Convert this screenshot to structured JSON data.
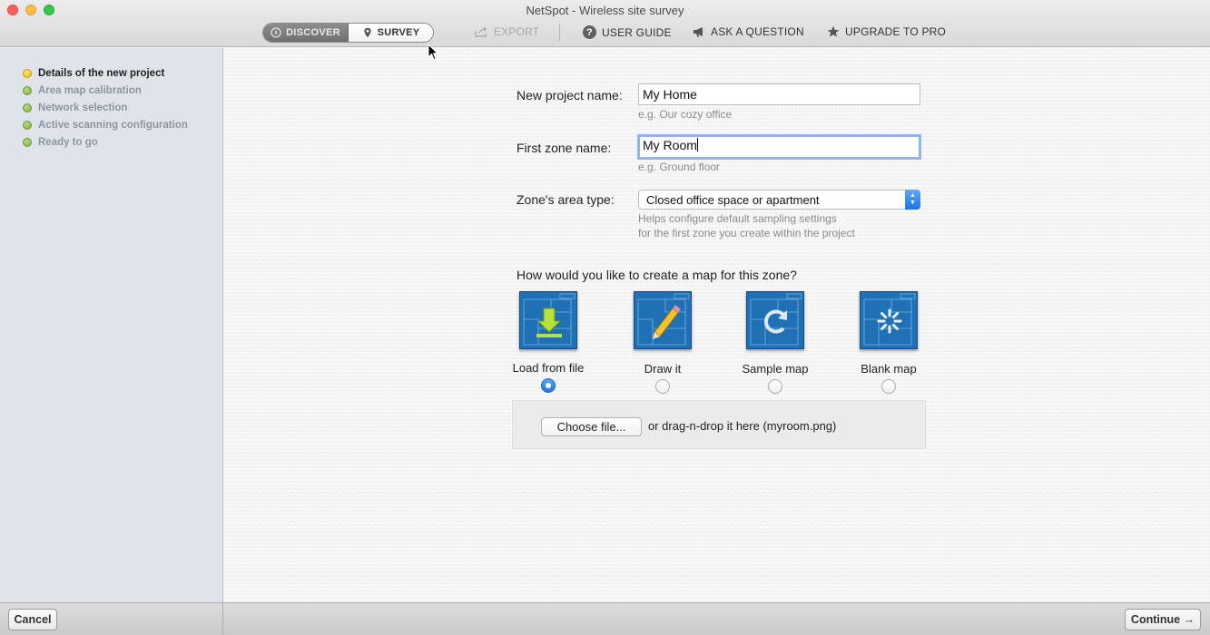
{
  "window": {
    "title": "NetSpot - Wireless site survey"
  },
  "toolbar": {
    "mode_discover": "DISCOVER",
    "mode_survey": "SURVEY",
    "active_mode": "SURVEY",
    "export": "EXPORT",
    "user_guide": "USER GUIDE",
    "ask_question": "ASK A QUESTION",
    "upgrade": "UPGRADE TO PRO"
  },
  "sidebar": {
    "steps": [
      {
        "label": "Details of the new project",
        "status": "current"
      },
      {
        "label": "Area map calibration",
        "status": "pending"
      },
      {
        "label": "Network selection",
        "status": "pending"
      },
      {
        "label": "Active scanning configuration",
        "status": "pending"
      },
      {
        "label": "Ready to go",
        "status": "pending"
      }
    ]
  },
  "form": {
    "project_name_label": "New project name:",
    "project_name_value": "My Home",
    "project_name_hint": "e.g. Our cozy office",
    "zone_name_label": "First zone name:",
    "zone_name_value": "My Room",
    "zone_name_hint": "e.g. Ground floor",
    "area_type_label": "Zone's area type:",
    "area_type_value": "Closed office space or apartment",
    "area_type_hint_1": "Helps configure default sampling settings",
    "area_type_hint_2": "for the first zone you create within the project",
    "map_question": "How would you like to create a map for this zone?",
    "map_options": [
      {
        "label": "Load from file",
        "icon": "download-arrow-icon",
        "selected": true
      },
      {
        "label": "Draw it",
        "icon": "pencil-icon",
        "selected": false
      },
      {
        "label": "Sample map",
        "icon": "refresh-icon",
        "selected": false
      },
      {
        "label": "Blank map",
        "icon": "loading-spinner-icon",
        "selected": false
      }
    ],
    "choose_file": "Choose file...",
    "drop_text": "or drag-n-drop it here (myroom.png)"
  },
  "footer": {
    "cancel": "Cancel",
    "continue": "Continue →"
  },
  "colors": {
    "accent_blue": "#1d74ec",
    "map_tile_blue": "#1f70b4",
    "step_done_green": "#7dae3e",
    "step_current_yellow": "#e7b81a"
  }
}
